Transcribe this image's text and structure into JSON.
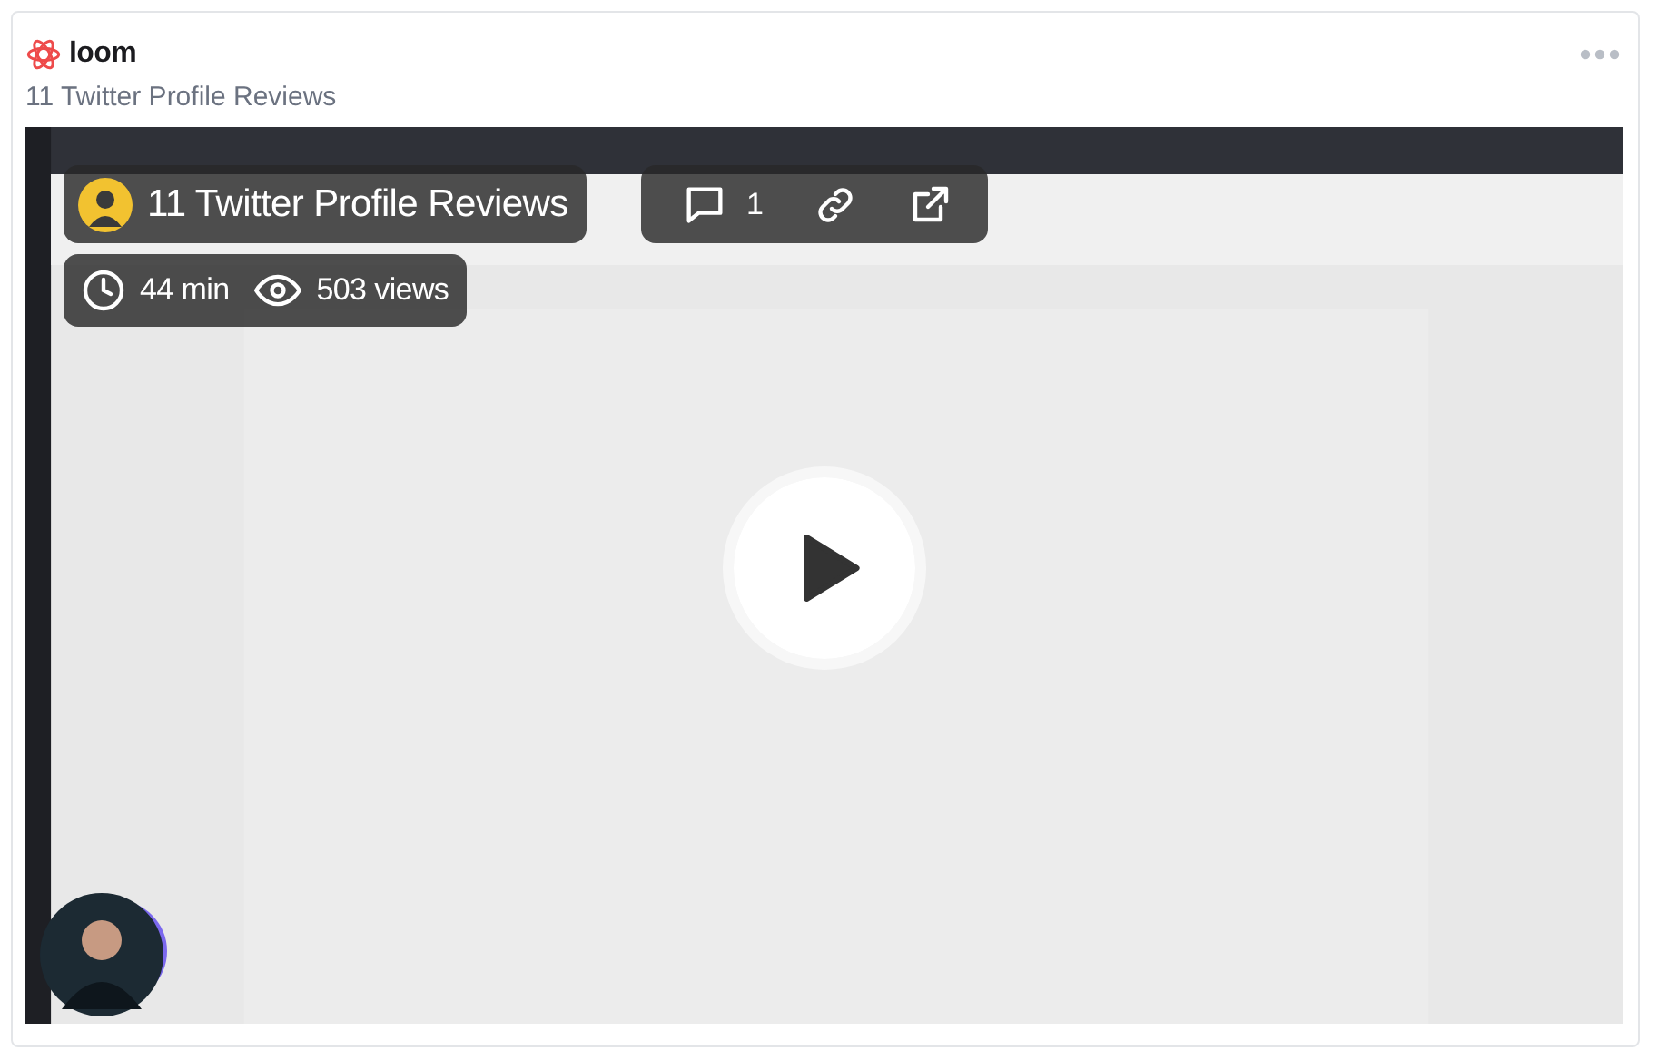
{
  "brand": {
    "name": "loom"
  },
  "title": "11 Twitter Profile Reviews",
  "video": {
    "title": "11 Twitter Profile Reviews",
    "comments": "1",
    "duration": "44 min",
    "views": "503 views"
  }
}
